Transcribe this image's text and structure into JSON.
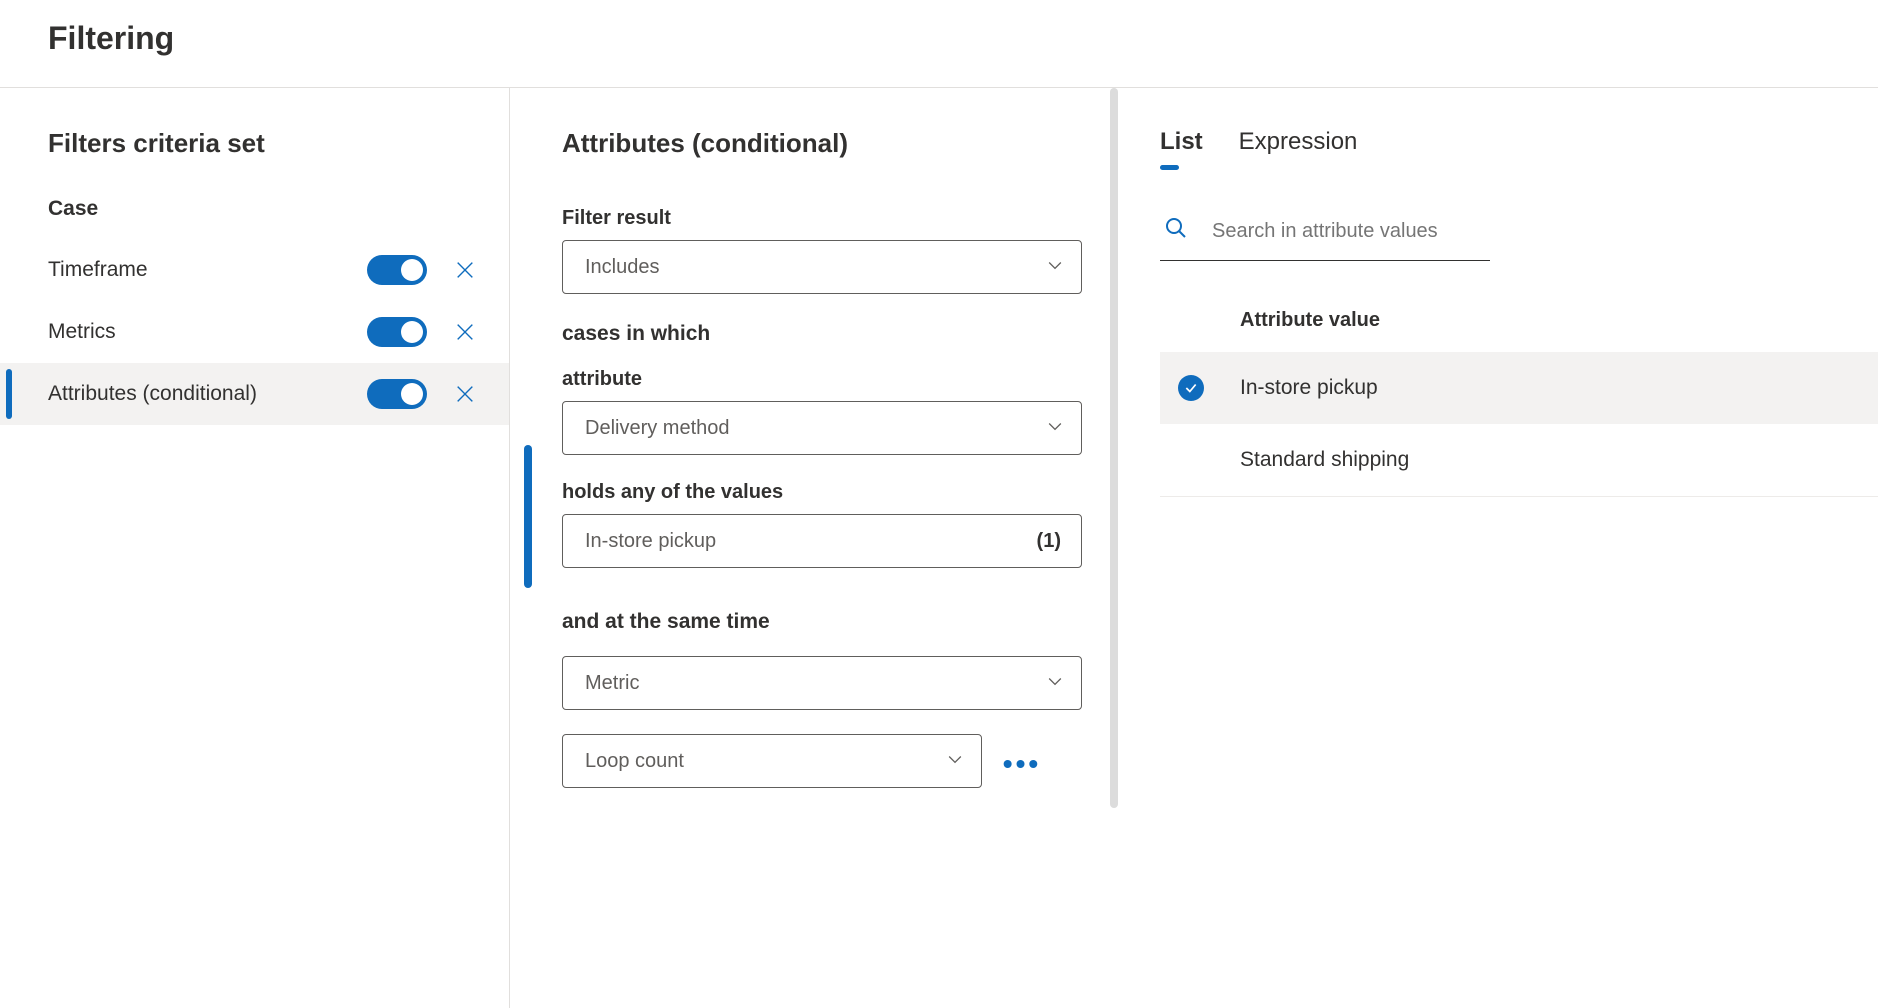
{
  "page": {
    "title": "Filtering"
  },
  "left": {
    "heading": "Filters criteria set",
    "group": "Case",
    "rows": [
      {
        "label": "Timeframe"
      },
      {
        "label": "Metrics"
      },
      {
        "label": "Attributes (conditional)"
      }
    ]
  },
  "mid": {
    "heading": "Attributes (conditional)",
    "filter_result_label": "Filter result",
    "filter_result_value": "Includes",
    "cases_text": "cases in which",
    "attribute_label": "attribute",
    "attribute_value": "Delivery method",
    "holds_label": "holds any of the values",
    "holds_value": "In-store pickup",
    "holds_count": "(1)",
    "and_label": "and at the same time",
    "and_value": "Metric",
    "metric2_value": "Loop count"
  },
  "right": {
    "tabs": {
      "list": "List",
      "expression": "Expression"
    },
    "search_placeholder": "Search in attribute values",
    "attr_header": "Attribute value",
    "values": [
      {
        "text": "In-store pickup",
        "selected": true
      },
      {
        "text": "Standard shipping",
        "selected": false
      }
    ]
  }
}
